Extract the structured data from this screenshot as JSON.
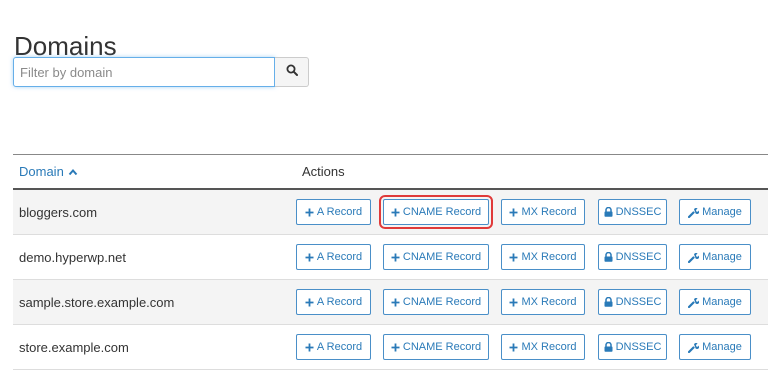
{
  "page": {
    "title": "Domains"
  },
  "search": {
    "placeholder": "Filter by domain",
    "button_icon": "search-icon"
  },
  "table": {
    "headers": {
      "domain": "Domain",
      "actions": "Actions"
    },
    "sort_indicator": "chevron-up-icon",
    "buttons": {
      "a_record": "A Record",
      "cname_record": "CNAME Record",
      "mx_record": "MX Record",
      "dnssec": "DNSSEC",
      "manage": "Manage"
    },
    "rows": [
      {
        "domain": "bloggers.com"
      },
      {
        "domain": "demo.hyperwp.net"
      },
      {
        "domain": "sample.store.example.com"
      },
      {
        "domain": "store.example.com"
      }
    ],
    "highlighted": {
      "row": 0,
      "button": "cname_record",
      "color": "#e03a3a"
    }
  },
  "colors": {
    "accent": "#2a7ab8",
    "border": "#4a8fc8"
  }
}
